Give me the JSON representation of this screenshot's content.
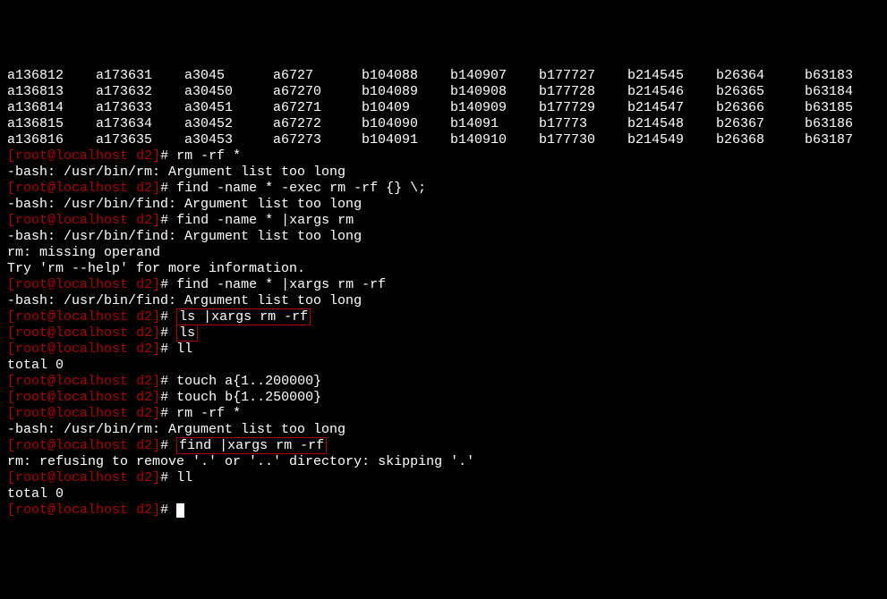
{
  "ls_output": [
    [
      "a136812",
      "a173631",
      "a3045",
      "a6727",
      "b104088",
      "b140907",
      "b177727",
      "b214545",
      "b26364",
      "b63183"
    ],
    [
      "a136813",
      "a173632",
      "a30450",
      "a67270",
      "b104089",
      "b140908",
      "b177728",
      "b214546",
      "b26365",
      "b63184"
    ],
    [
      "a136814",
      "a173633",
      "a30451",
      "a67271",
      "b10409",
      "b140909",
      "b177729",
      "b214547",
      "b26366",
      "b63185"
    ],
    [
      "a136815",
      "a173634",
      "a30452",
      "a67272",
      "b104090",
      "b14091",
      "b17773",
      "b214548",
      "b26367",
      "b63186"
    ],
    [
      "a136816",
      "a173635",
      "a30453",
      "a67273",
      "b104091",
      "b140910",
      "b177730",
      "b214549",
      "b26368",
      "b63187"
    ]
  ],
  "prompt": {
    "open": "[",
    "user": "root",
    "at": "@",
    "host": "localhost",
    "dir": " d2",
    "close": "]",
    "hash": "# "
  },
  "lines": [
    {
      "type": "cmd",
      "text": "rm -rf *"
    },
    {
      "type": "out",
      "text": "-bash: /usr/bin/rm: Argument list too long"
    },
    {
      "type": "cmd",
      "text": "find -name * -exec rm -rf {} \\;"
    },
    {
      "type": "out",
      "text": "-bash: /usr/bin/find: Argument list too long"
    },
    {
      "type": "cmd",
      "text": "find -name * |xargs rm"
    },
    {
      "type": "out",
      "text": "-bash: /usr/bin/find: Argument list too long"
    },
    {
      "type": "out",
      "text": "rm: missing operand"
    },
    {
      "type": "out",
      "text": "Try 'rm --help' for more information."
    },
    {
      "type": "cmd",
      "text": "find -name * |xargs rm -rf"
    },
    {
      "type": "out",
      "text": "-bash: /usr/bin/find: Argument list too long"
    },
    {
      "type": "cmd-box",
      "text": "ls |xargs rm -rf"
    },
    {
      "type": "cmd-box",
      "text": "ls"
    },
    {
      "type": "cmd",
      "text": "ll"
    },
    {
      "type": "out",
      "text": "total 0"
    },
    {
      "type": "cmd",
      "text": "touch a{1..200000}"
    },
    {
      "type": "cmd",
      "text": "touch b{1..250000}"
    },
    {
      "type": "cmd",
      "text": "rm -rf *"
    },
    {
      "type": "out",
      "text": "-bash: /usr/bin/rm: Argument list too long"
    },
    {
      "type": "cmd-box",
      "text": "find |xargs rm -rf"
    },
    {
      "type": "out",
      "text": "rm: refusing to remove '.' or '..' directory: skipping '.'"
    },
    {
      "type": "cmd",
      "text": "ll"
    },
    {
      "type": "out",
      "text": "total 0"
    },
    {
      "type": "cmd-cursor",
      "text": ""
    }
  ]
}
